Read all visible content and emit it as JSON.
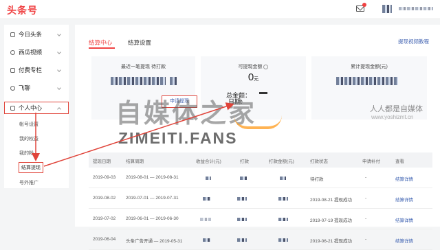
{
  "app": {
    "logo": "头条号"
  },
  "sidebar": {
    "items": [
      {
        "label": "今日头条"
      },
      {
        "label": "西瓜视频"
      },
      {
        "label": "付费专栏"
      },
      {
        "label": "飞聊"
      },
      {
        "label": "个人中心"
      }
    ],
    "sub_items": [
      {
        "label": "帐号设置"
      },
      {
        "label": "我的权益"
      },
      {
        "label": "我的粉"
      },
      {
        "label": "结算提现"
      },
      {
        "label": "号外推广"
      }
    ]
  },
  "tabs": [
    {
      "label": "结算中心"
    },
    {
      "label": "结算设置"
    }
  ],
  "tutorial_link": "提现视频教程",
  "cards": {
    "recent": {
      "title": "最近一笔提现 待打款"
    },
    "withdrawable": {
      "title": "可提现金额",
      "amount": "0",
      "unit": "元"
    },
    "total": {
      "title": "累计提现金额(元)"
    }
  },
  "total_amount_label": "总金额：",
  "date_label": "日期:",
  "apply_button": "申请提现",
  "table": {
    "headers": [
      "提现日期",
      "结算周期",
      "收益合计(元)",
      "打款",
      "打款金额(元)",
      "打款状态",
      "申请补付",
      "查看"
    ],
    "rows": [
      {
        "date": "2019-09-03",
        "period": "2019-08-01 — 2019-08-31",
        "status": "待打款",
        "supplement": "-",
        "view": "结算详情"
      },
      {
        "date": "2019-08-02",
        "period": "2019-07-01 — 2019-07-31",
        "status": "2019-08-21 提现成功",
        "supplement": "-",
        "view": "结算详情"
      },
      {
        "date": "2019-07-02",
        "period": "2019-06-01 — 2019-06-30",
        "status": "2019-07-19 提现成功",
        "supplement": "-",
        "view": "结算详情"
      },
      {
        "date": "2019-06-04",
        "period": "头条广告开通 — 2019-05-31",
        "status": "2019-06-21 提现成功",
        "supplement": "-",
        "view": "结算详情"
      }
    ]
  },
  "watermark": {
    "brand_cn": "自媒体之家",
    "brand_latin": "ZIMEITI.FANS",
    "site_cn": "人人都是自媒体",
    "site_url": "www.yoshizmt.cn"
  },
  "colors": {
    "accent": "#f04142",
    "annotation": "#e0443a",
    "link": "#3a5fb0"
  }
}
